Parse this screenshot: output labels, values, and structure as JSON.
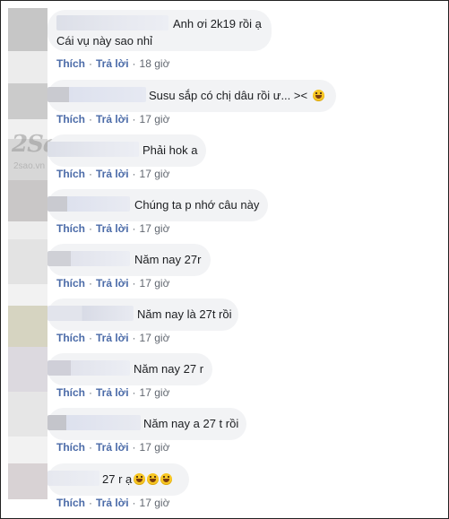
{
  "watermark": {
    "logo": "2Sao",
    "url": "2sao.vn"
  },
  "actions": {
    "like": "Thích",
    "reply": "Trả lời",
    "separator": "·"
  },
  "comments": [
    {
      "line1": "Anh ơi 2k19 rồi ạ",
      "line2": "Cái vụ này sao nhỉ",
      "time": "18 giờ",
      "emoji_count": 0
    },
    {
      "text": "Susu sắp có chị dâu rồi ư... ><",
      "time": "17 giờ",
      "emoji_count": 1
    },
    {
      "text": "Phải hok a",
      "time": "17 giờ",
      "emoji_count": 0
    },
    {
      "text": "Chúng ta p nhớ câu này",
      "time": "17 giờ",
      "emoji_count": 0
    },
    {
      "text": "Năm nay 27r",
      "time": "17 giờ",
      "emoji_count": 0
    },
    {
      "text": "Năm nay là 27t rồi",
      "time": "17 giờ",
      "emoji_count": 0
    },
    {
      "text": "Năm nay 27 r",
      "time": "17 giờ",
      "emoji_count": 0
    },
    {
      "text": "Năm nay a 27 t rồi",
      "time": "17 giờ",
      "emoji_count": 0
    },
    {
      "text": "27 r ạ",
      "time": "17 giờ",
      "emoji_count": 3
    }
  ]
}
